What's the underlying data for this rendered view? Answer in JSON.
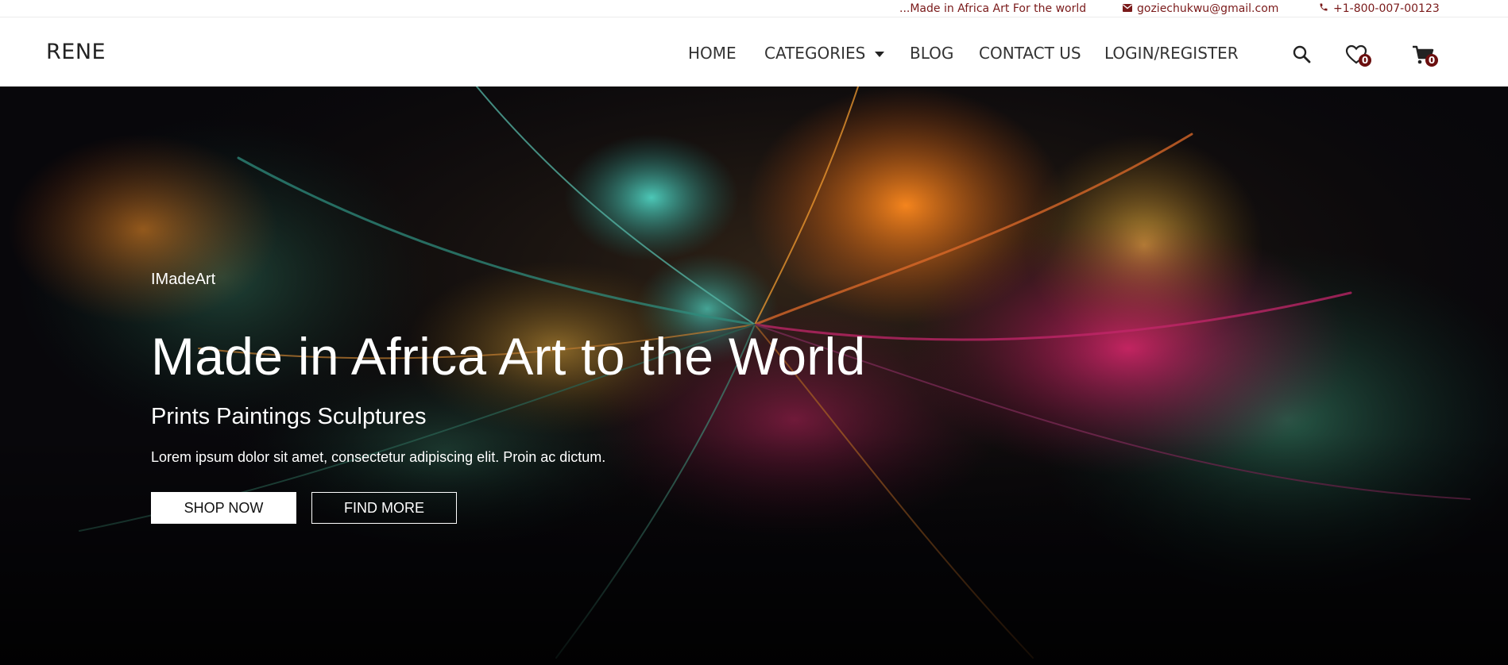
{
  "topbar": {
    "tagline": "...Made in Africa Art For the world",
    "email": "goziechukwu@gmail.com",
    "email_icon": "mail-icon",
    "phone": "+1-800-007-00123",
    "phone_icon": "phone-icon",
    "text_color": "#7a1a1a"
  },
  "nav": {
    "brand": "RENE",
    "links": {
      "home": "HOME",
      "categories": "CATEGORIES",
      "blog": "BLOG",
      "contact": "CONTACT US",
      "login": "LOGIN/REGISTER"
    },
    "icons": {
      "search": "search-icon",
      "wishlist": "heart-icon",
      "cart": "cart-icon"
    },
    "wishlist_count": "0",
    "cart_count": "0",
    "badge_color": "#6b0f0f"
  },
  "hero": {
    "eyebrow": "IMadeArt",
    "headline": "Made in Africa Art to the World",
    "subhead": "Prints Paintings Sculptures",
    "description": "Lorem ipsum dolor sit amet, consectetur adipiscing elit. Proin ac dictum.",
    "shop_button": "SHOP NOW",
    "find_button": "FIND MORE"
  }
}
